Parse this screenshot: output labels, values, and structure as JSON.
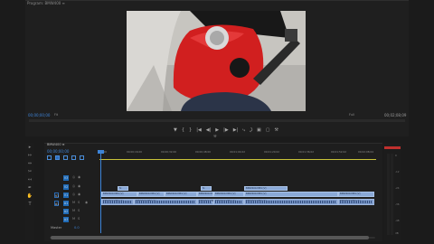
{
  "program": {
    "tab_title": "Program: BMW400 ≡",
    "timecode_left": "00;00;00;00",
    "fit": "Fit",
    "quality": "Full",
    "timecode_right": "00;02;08;09"
  },
  "transport": {
    "buttons": [
      "▼",
      "{",
      "}",
      "|◀",
      "◀|",
      "▶",
      "|▶",
      "▶|",
      "⤷",
      "⤸",
      "▣",
      "▢",
      "⚒"
    ]
  },
  "timeline": {
    "sequence_tab": "BMW400 ≡",
    "timecode": "00;00;00;00",
    "ruler": [
      "00;00",
      "00;00;16;00",
      "00;00;32;00",
      "00;00;48;00",
      "00;01;04;02",
      "00;01;20;02",
      "00;01;36;02",
      "00;01;52;02",
      "00;02;08;04"
    ],
    "video_tracks": [
      {
        "label": "V3",
        "src": "",
        "icons": [
          "◎",
          "◉"
        ]
      },
      {
        "label": "V2",
        "src": "",
        "icons": [
          "◎",
          "◉"
        ]
      },
      {
        "label": "V1",
        "src": "V1",
        "icons": [
          "◎",
          "◉"
        ]
      }
    ],
    "audio_tracks": [
      {
        "label": "A1",
        "src": "A1",
        "icons": [
          "M",
          "S"
        ]
      },
      {
        "label": "A2",
        "src": "",
        "icons": [
          "M",
          "S"
        ]
      },
      {
        "label": "A3",
        "src": "",
        "icons": [
          "M",
          "S"
        ]
      }
    ],
    "master": {
      "label": "Master",
      "value": "0.0"
    },
    "clips_v2": [
      "fx",
      "fx",
      "BMW400.MP4 [V]"
    ],
    "clips_v1": [
      "BMW400.MP4 [V]",
      "BMW400.MP4 [V]",
      "BMW400.MP4 [V]",
      "BMW400.MP4 [V]",
      "BMW400.MP4 [V]",
      "BMW400.MP4 [V]",
      "BMW400.MP4 [V]"
    ],
    "clips_a1": [
      "BMW400.MP4 [A]",
      "BMW400.MP4 [A]",
      "BMW400.MP4 [A]",
      "BMW400.MP4 [A]",
      "BMW400.MP4 [A]",
      "BMW400.MP4 [A]"
    ]
  },
  "tools": [
    "▸",
    "↦",
    "⇔",
    "✂",
    "↤",
    "✒",
    "✋",
    "T"
  ],
  "meter": {
    "ticks": [
      "0",
      "-12",
      "-24",
      "-36",
      "-48",
      "dB"
    ]
  }
}
